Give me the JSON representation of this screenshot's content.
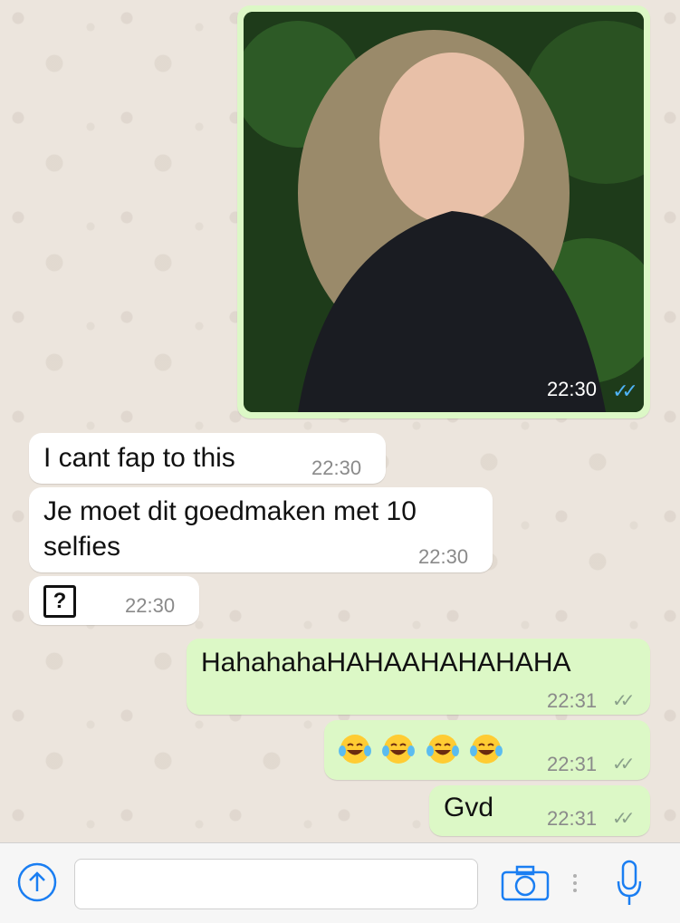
{
  "messages": [
    {
      "type": "image",
      "time": "22:30"
    },
    {
      "type": "text",
      "text": "I cant fap to this",
      "time": "22:30"
    },
    {
      "type": "text",
      "line1": "Je moet dit goedmaken met 10",
      "line2": "selfies",
      "time": "22:30"
    },
    {
      "type": "unknown",
      "symbol": "?",
      "time": "22:30"
    },
    {
      "type": "text",
      "text": "HahahahaHAHAAHAHAHAHA",
      "time": "22:31"
    },
    {
      "type": "emoji",
      "emojis": [
        "face-with-tears-of-joy",
        "face-with-tears-of-joy",
        "face-with-tears-of-joy",
        "face-with-tears-of-joy"
      ],
      "time": "22:31"
    },
    {
      "type": "text",
      "text": "Gvd",
      "time": "22:31"
    }
  ],
  "read_tick_color": "#4fb3f6",
  "delivered_tick_color": "#8aa08a",
  "input": {
    "placeholder": ""
  },
  "icons": {
    "attach": "upload-arrow-icon",
    "camera": "camera-icon",
    "mic": "microphone-icon"
  }
}
